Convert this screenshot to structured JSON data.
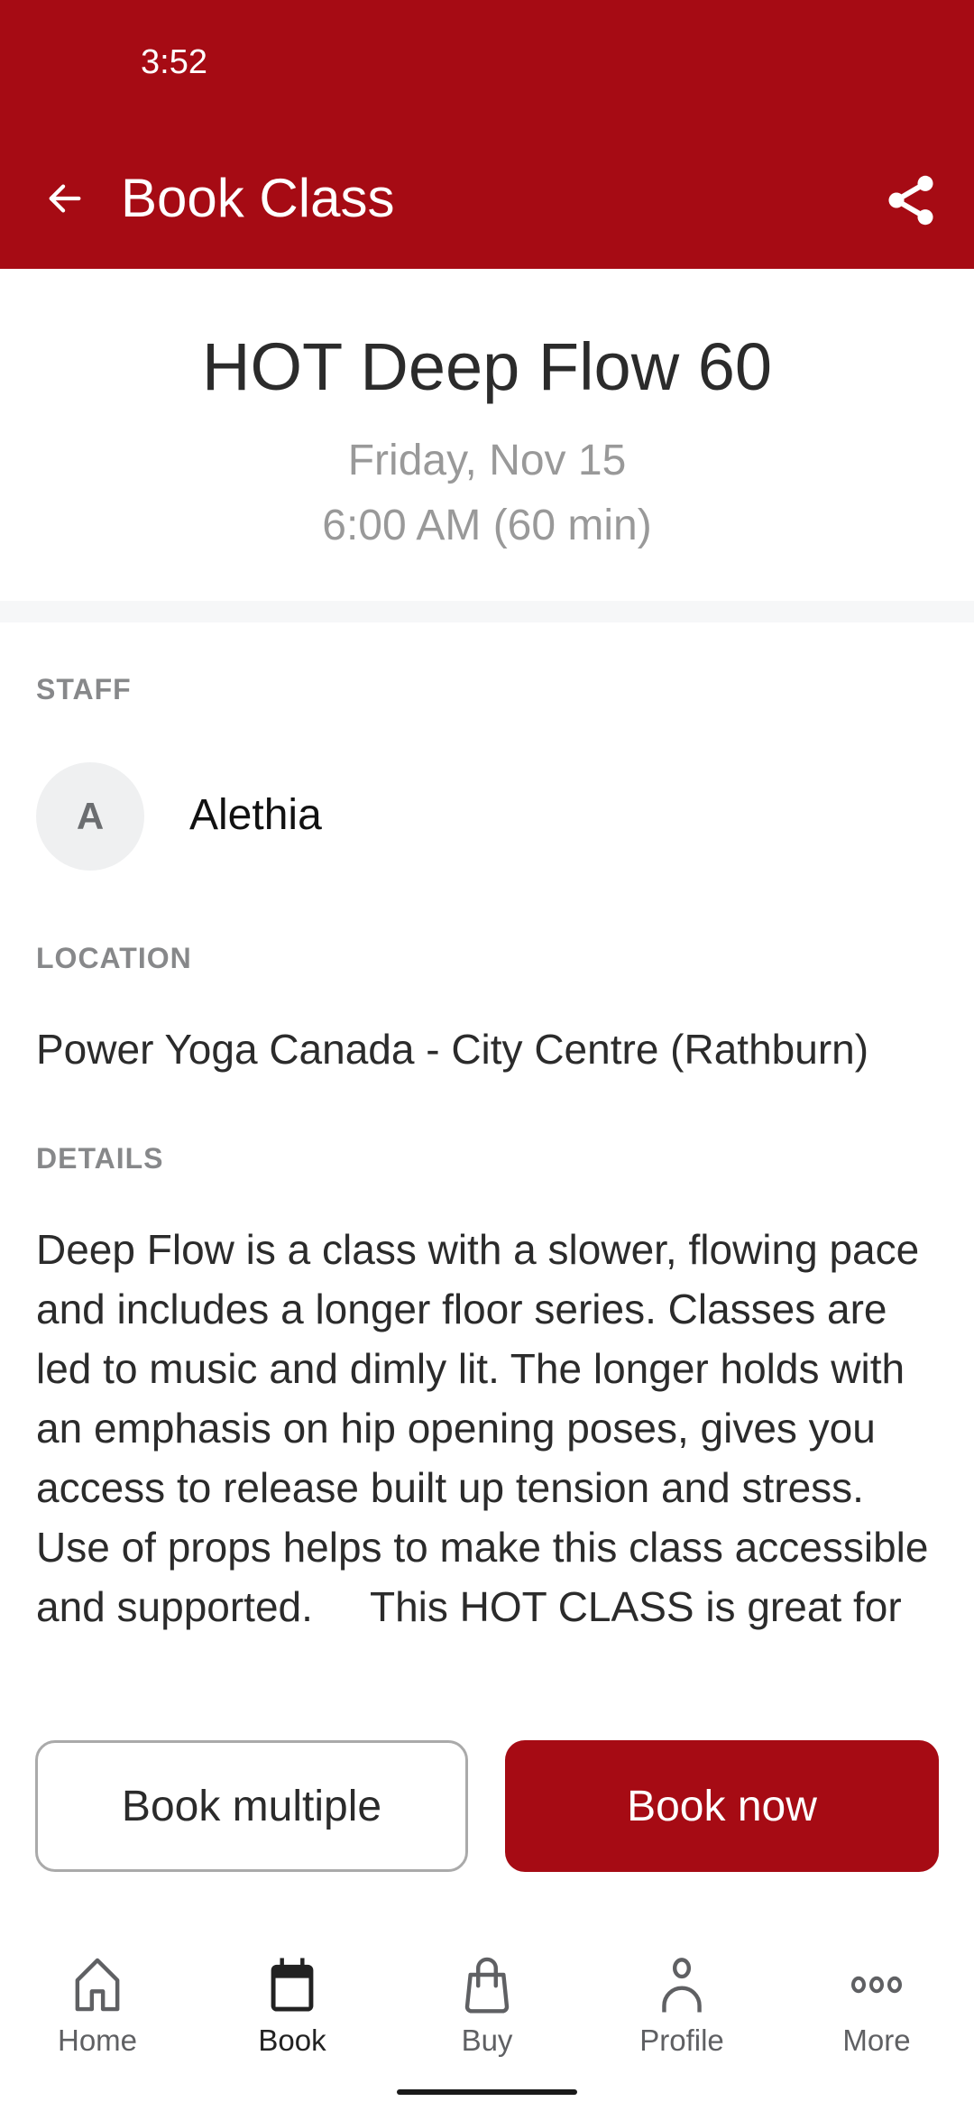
{
  "status_bar": {
    "time": "3:52"
  },
  "app_bar": {
    "title": "Book Class",
    "back_icon": "arrow-left-icon",
    "share_icon": "share-icon"
  },
  "class": {
    "title": "HOT Deep Flow 60",
    "date": "Friday, Nov 15",
    "time": "6:00 AM (60 min)"
  },
  "staff": {
    "label": "STAFF",
    "initial": "A",
    "name": "Alethia"
  },
  "location": {
    "label": "LOCATION",
    "name": "Power Yoga Canada - City Centre (Rathburn)"
  },
  "details": {
    "label": "DETAILS",
    "text": "Deep Flow is a class with a slower, flowing pace and includes a longer floor series. Classes are led to music and dimly lit. The longer holds with an emphasis on hip opening poses, gives you access to release built up tension and stress. Use of props helps to make this class accessible and supported.     This HOT CLASS is great for"
  },
  "actions": {
    "book_multiple": "Book multiple",
    "book_now": "Book now"
  },
  "tabs": [
    {
      "label": "Home",
      "icon": "home-icon",
      "active": false
    },
    {
      "label": "Book",
      "icon": "calendar-icon",
      "active": true
    },
    {
      "label": "Buy",
      "icon": "shopping-bag-icon",
      "active": false
    },
    {
      "label": "Profile",
      "icon": "person-icon",
      "active": false
    },
    {
      "label": "More",
      "icon": "more-dots-icon",
      "active": false
    }
  ],
  "colors": {
    "brand": "#a60b14",
    "muted_text": "#999999",
    "section_label": "#87888a"
  }
}
